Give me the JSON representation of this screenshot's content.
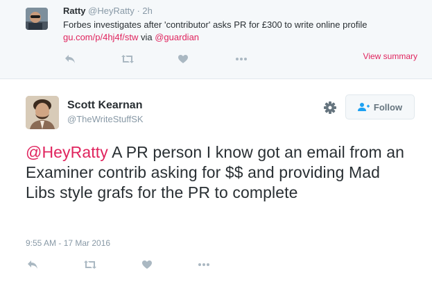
{
  "parent_tweet": {
    "name": "Ratty",
    "handle": "@HeyRatty",
    "separator": "·",
    "time": "2h",
    "text_line1": "Forbes investigates after 'contributor' asks PR for £300 to write online profile",
    "link": "gu.com/p/4hj4f/stw",
    "via": " via ",
    "mention": "@guardian",
    "view_summary": "View summary"
  },
  "main_tweet": {
    "name": "Scott Kearnan",
    "handle": "@TheWriteStuffSK",
    "follow_label": "Follow",
    "mention": "@HeyRatty",
    "text": " A PR person I know got an email from an Examiner contrib asking for $$ and providing Mad Libs style grafs for the PR to complete",
    "timestamp": "9:55 AM - 17 Mar 2016"
  },
  "colors": {
    "accent": "#e0245e",
    "muted": "#8899a6",
    "icon": "#aab8c2"
  },
  "icons": [
    "reply-icon",
    "retweet-icon",
    "like-icon",
    "more-icon",
    "gear-icon",
    "follow-user-icon"
  ]
}
